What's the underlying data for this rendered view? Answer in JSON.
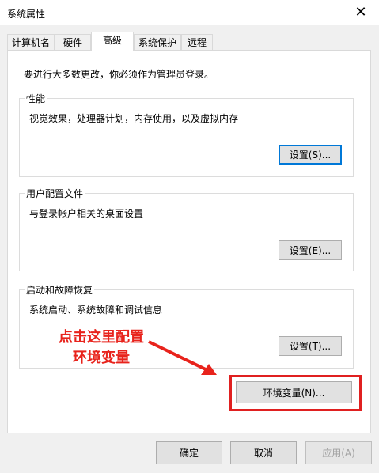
{
  "window": {
    "title": "系统属性",
    "close_glyph": "✕"
  },
  "tabs": [
    {
      "label": "计算机名"
    },
    {
      "label": "硬件"
    },
    {
      "label": "高级",
      "active": true
    },
    {
      "label": "系统保护"
    },
    {
      "label": "远程"
    }
  ],
  "note": "要进行大多数更改，你必须作为管理员登录。",
  "performance": {
    "title": "性能",
    "desc": "视觉效果，处理器计划，内存使用，以及虚拟内存",
    "button": "设置(S)..."
  },
  "profiles": {
    "title": "用户配置文件",
    "desc": "与登录帐户相关的桌面设置",
    "button": "设置(E)..."
  },
  "startup": {
    "title": "启动和故障恢复",
    "desc": "系统启动、系统故障和调试信息",
    "button": "设置(T)..."
  },
  "env_button": "环境变量(N)...",
  "annotation": {
    "line1": "点击这里配置",
    "line2": "环境变量",
    "color": "#e8231c"
  },
  "footer": {
    "ok": "确定",
    "cancel": "取消",
    "apply": "应用(A)"
  }
}
